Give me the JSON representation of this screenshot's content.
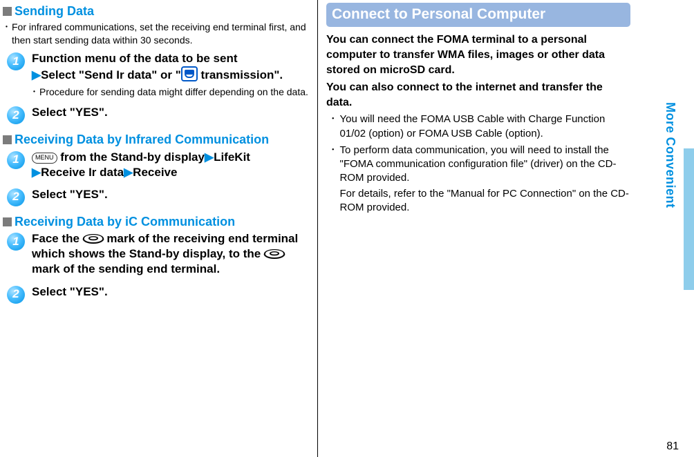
{
  "leftColumn": {
    "sendingData": {
      "heading": "Sending Data",
      "note": "For infrared communications, set the receiving end terminal ﬁrst, and then start sending data within 30 seconds.",
      "step1": {
        "pre": "Function menu of the data to be sent",
        "select": "Select \"Send Ir data\" or \"",
        "afterIcon": " transmission\".",
        "sub": "Procedure for sending data might differ depending on the data."
      },
      "step2": "Select \"YES\"."
    },
    "receivingIr": {
      "heading": "Receiving Data by Infrared Communication",
      "step1": {
        "menuLabel": "MENU",
        "after": " from the Stand-by display",
        "lifekit": "LifeKit",
        "receiveIr": "Receive Ir data",
        "receive": "Receive"
      },
      "step2": "Select \"YES\"."
    },
    "receivingIc": {
      "heading": "Receiving Data by iC Communication",
      "step1": {
        "a": "Face the ",
        "b": " mark of the receiving end terminal which shows the Stand-by display, to the ",
        "c": " mark of the sending end terminal."
      },
      "step2": "Select \"YES\"."
    }
  },
  "rightColumn": {
    "mainHeading": "Connect to Personal Computer",
    "intro1": "You can connect the FOMA terminal to a personal computer to transfer WMA ﬁles, images or other data stored on microSD card.",
    "intro2": "You can also connect to the internet and transfer the data.",
    "bullets": {
      "b1": "You will need the FOMA USB Cable with Charge Function 01/02 (option) or FOMA USB Cable (option).",
      "b2a": "To perform data communication, you will need to install the \"FOMA communication conﬁguration ﬁle\" (driver) on the CD-ROM provided.",
      "b2b": "For details, refer to the \"Manual for PC Connection\" on the CD-ROM provided."
    }
  },
  "side": {
    "tab": "More Convenient",
    "pageNumber": "81"
  },
  "numbers": {
    "one": "1",
    "two": "2"
  }
}
